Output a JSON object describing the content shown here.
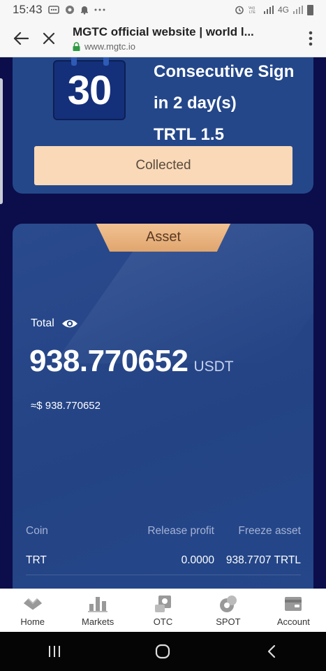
{
  "status_bar": {
    "time": "15:43",
    "network_label": "4G"
  },
  "browser": {
    "page_title": "MGTC official website | world l...",
    "url": "www.mgtc.io"
  },
  "sign_in": {
    "day_number": "30",
    "line1": "Consecutive Sign",
    "line2": "in 2 day(s)",
    "line3": "TRTL 1.5",
    "button_label": "Collected"
  },
  "asset": {
    "tab_label": "Asset",
    "total_label": "Total",
    "total_value": "938.770652",
    "total_unit": "USDT",
    "approx_value": "≈$ 938.770652",
    "table": {
      "headers": [
        "Coin",
        "Release profit",
        "Freeze asset"
      ],
      "rows": [
        [
          "TRT",
          "0.0000",
          "938.7707 TRTL"
        ]
      ]
    }
  },
  "bottom_nav": {
    "items": [
      {
        "label": "Home",
        "icon": "home-icon"
      },
      {
        "label": "Markets",
        "icon": "markets-icon"
      },
      {
        "label": "OTC",
        "icon": "otc-icon"
      },
      {
        "label": "SPOT",
        "icon": "spot-icon"
      },
      {
        "label": "Account",
        "icon": "account-icon"
      }
    ]
  },
  "colors": {
    "page_bg": "#0b0e4a",
    "card_bg": "#24478a",
    "button_bg": "#f9d9b8",
    "tab_bg": "#e0a56e"
  }
}
